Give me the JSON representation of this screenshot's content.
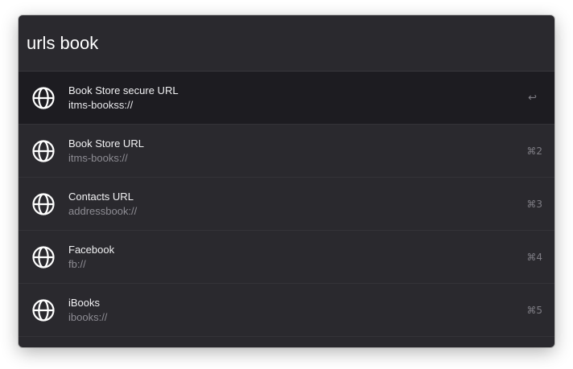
{
  "search": {
    "query": "urls book"
  },
  "results": [
    {
      "title": "Book Store secure URL",
      "subtitle": "itms-bookss://",
      "shortcut": "↩",
      "icon": "globe-icon",
      "selected": true
    },
    {
      "title": "Book Store URL",
      "subtitle": "itms-books://",
      "shortcut": "⌘2",
      "icon": "globe-icon",
      "selected": false
    },
    {
      "title": "Contacts URL",
      "subtitle": "addressbook://",
      "shortcut": "⌘3",
      "icon": "globe-icon",
      "selected": false
    },
    {
      "title": "Facebook",
      "subtitle": "fb://",
      "shortcut": "⌘4",
      "icon": "globe-icon",
      "selected": false
    },
    {
      "title": "iBooks",
      "subtitle": "ibooks://",
      "shortcut": "⌘5",
      "icon": "globe-icon",
      "selected": false
    }
  ],
  "colors": {
    "panel_background": "#2a292e",
    "selected_row_background": "#1d1c21",
    "title_text": "#f2f2f4",
    "subtitle_text": "#8d8c93",
    "shortcut_text": "#7e7d84"
  }
}
